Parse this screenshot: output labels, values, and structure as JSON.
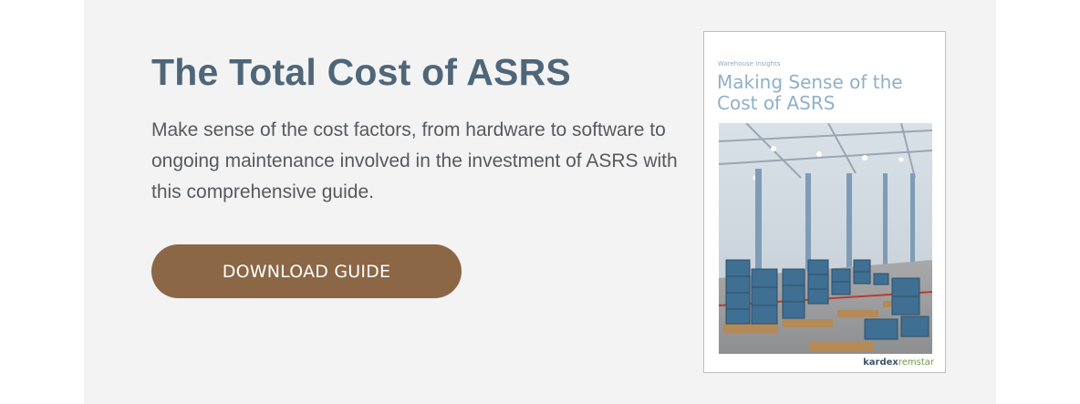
{
  "promo": {
    "title": "The Total Cost of ASRS",
    "description": "Make sense of the cost factors, from hardware to software to ongoing maintenance involved in the investment of ASRS with this comprehensive guide.",
    "cta_label": "DOWNLOAD GUIDE"
  },
  "cover": {
    "eyebrow": "Warehouse Insights",
    "title": "Making Sense of the Cost of ASRS",
    "brand_primary": "kardex",
    "brand_secondary": "remstar"
  },
  "colors": {
    "title": "#4f6679",
    "button": "#8b6746",
    "banner_bg": "#f3f3f3",
    "cover_title": "#8fb0c9",
    "brand_green": "#6c9a3f"
  }
}
